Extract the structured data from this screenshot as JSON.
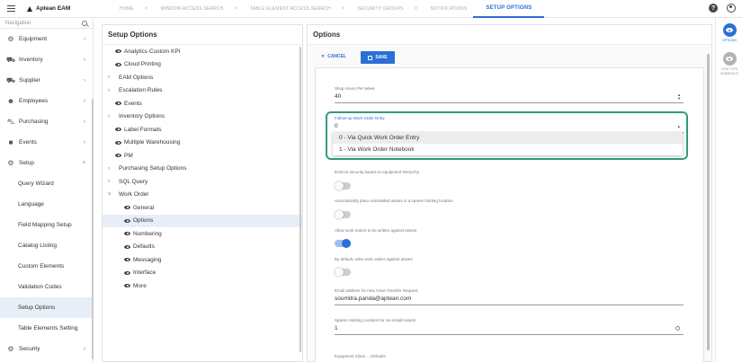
{
  "app": {
    "brand": "Aptean EAM"
  },
  "tabs": [
    {
      "label": "HOME",
      "active": false
    },
    {
      "label": "WINDOW ACCESS SEARCH",
      "active": false
    },
    {
      "label": "TABLE ELEMENT ACCESS SEARCH",
      "active": false
    },
    {
      "label": "SECURITY GROUPS",
      "active": false
    },
    {
      "label": "NOTIFICATIONS",
      "active": false
    },
    {
      "label": "SETUP OPTIONS",
      "active": true
    }
  ],
  "nav": {
    "search_placeholder": "Navigation",
    "items": [
      {
        "label": "Equipment",
        "icon": "equipment-icon"
      },
      {
        "label": "Inventory",
        "icon": "inventory-icon"
      },
      {
        "label": "Supplier",
        "icon": "supplier-icon"
      },
      {
        "label": "Employees",
        "icon": "employees-icon"
      },
      {
        "label": "Purchasing",
        "icon": "cart-icon"
      },
      {
        "label": "Events",
        "icon": "briefcase-icon"
      },
      {
        "label": "Setup",
        "icon": "gear-icon"
      }
    ],
    "setup_sub": [
      "Query Wizard",
      "Language",
      "Field Mapping Setup",
      "Catalog Listing",
      "Custom Elements",
      "Validation Codes",
      "Setup Options",
      "Table Elements Setting"
    ],
    "security": "Security"
  },
  "setup_panel": {
    "title": "Setup Options",
    "rows": [
      "Analytics Custom KPI",
      "Cloud Printing",
      "EAM Options",
      "Escalation Rules",
      "Events",
      "Inventory Options",
      "Label Formats",
      "Multiple Warehousing",
      "PM",
      "Purchasing Setup Options",
      "SQL Query",
      "Work Order",
      "General",
      "Options",
      "Numbering",
      "Defaults",
      "Messaging",
      "Interface",
      "More"
    ]
  },
  "options_panel": {
    "title": "Options",
    "cancel_label": "CANCEL",
    "save_label": "SAVE",
    "shop_hours_label": "Shop Hours Per Week",
    "shop_hours_value": "40",
    "follow_label": "Follow-up Work Order Entry",
    "follow_value": "0",
    "dropdown_options": [
      "0 - Via Quick Work Order Entry",
      "1 - Via Work Order Notebook"
    ],
    "enforce_label": "Enforce security based on equipment hierarchy",
    "auto_place_label": "Automatically place uninstalled assets in a spares holding location",
    "allow_wo_label": "Allow work orders to be written against assets",
    "default_wo_label": "By default, write work orders against assets",
    "email_label": "Email address for new Asset Transfer Request",
    "email_value": "soumitra.panda@aptean.com",
    "spares_label": "Spares Holding Location for Un-install Assets",
    "spares_value": "1",
    "cut_label": "Equipment Class ... Defaults"
  },
  "right_rail": {
    "options_label": "OPTIONS",
    "view_label": "ITEM TYPE SUBMENUS"
  }
}
